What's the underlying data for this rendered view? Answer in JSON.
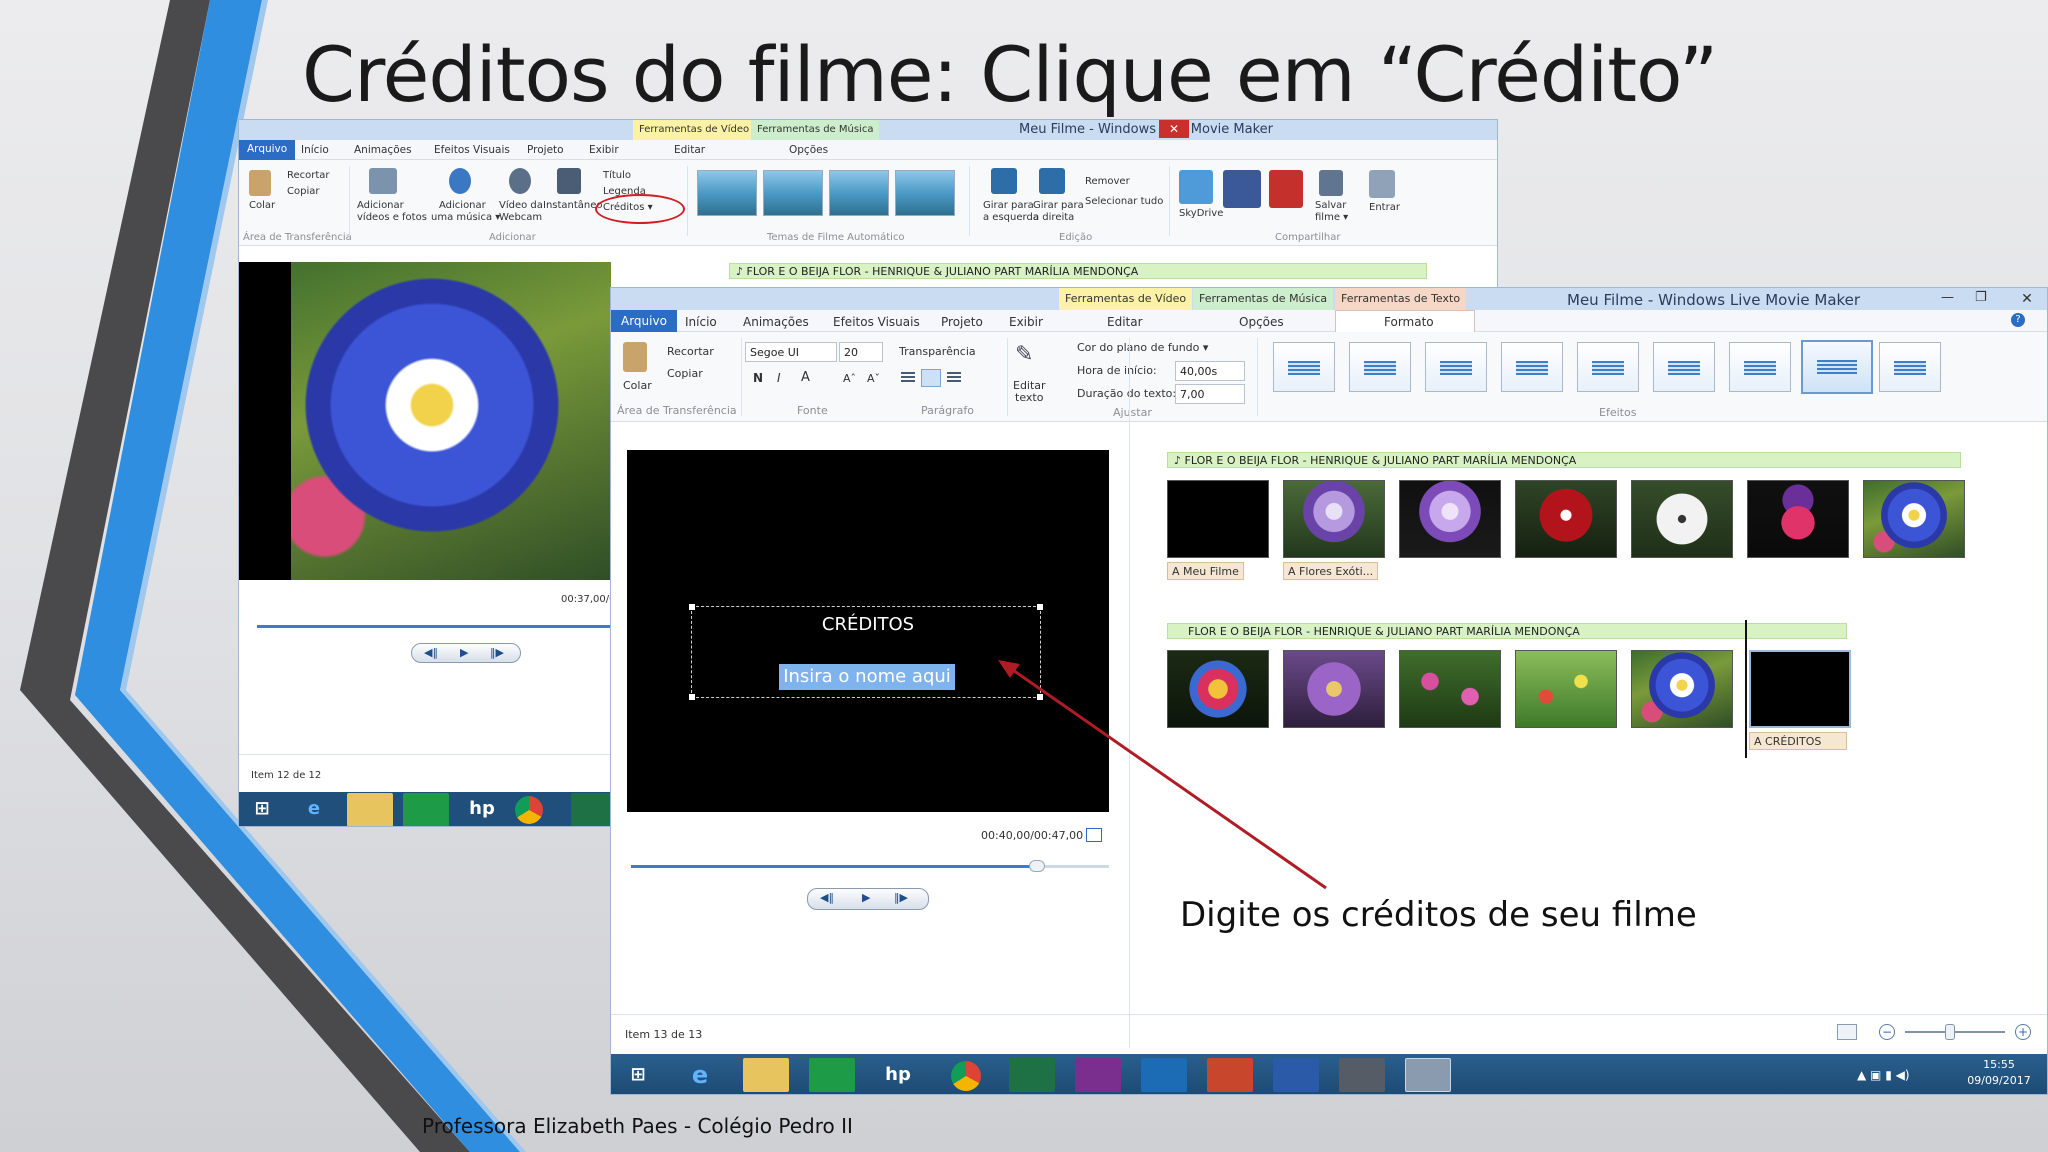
{
  "slide": {
    "title": "Créditos do filme: Clique em “Crédito”",
    "caption": "Digite os créditos de seu filme",
    "footer": "Professora Elizabeth Paes - Colégio Pedro II",
    "accent_blue": "#2f8ee0",
    "arrow_color": "#b01c24"
  },
  "back_window": {
    "title": "Meu Filme - Windows Live Movie Maker",
    "context_tabs": [
      "Ferramentas de Vídeo",
      "Ferramentas de Música"
    ],
    "context_subtabs": [
      "Editar",
      "Opções"
    ],
    "menu": [
      "Arquivo",
      "Início",
      "Animações",
      "Efeitos Visuais",
      "Projeto",
      "Exibir"
    ],
    "ribbon": {
      "paste": "Colar",
      "cut": "Recortar",
      "copy": "Copiar",
      "add_videos": [
        "Adicionar",
        "vídeos e fotos"
      ],
      "add_music": [
        "Adicionar",
        "uma música ▾"
      ],
      "webcam": [
        "Vídeo da",
        "Webcam"
      ],
      "snapshot": "Instantâneo",
      "titulo": "Título",
      "legenda": "Legenda",
      "creditos": "Créditos ▾",
      "rotate_left": [
        "Girar para",
        "a esquerda"
      ],
      "rotate_right": [
        "Girar para",
        "a direita"
      ],
      "remove": "Remover",
      "select_all": "Selecionar tudo",
      "skydrive": "SkyDrive",
      "save_movie": [
        "Salvar",
        "filme ▾"
      ],
      "signin": "Entrar",
      "groups": [
        "Área de Transferência",
        "Adicionar",
        "Temas de Filme Automático",
        "Edição",
        "Compartilhar"
      ]
    },
    "storyboard_header": "♪ FLOR E O BEIJA FLOR - HENRIQUE & JULIANO PART MARÍLIA MENDONÇA",
    "time": "00:37,00/0",
    "status": "Item 12 de 12"
  },
  "front_window": {
    "title": "Meu Filme - Windows Live Movie Maker",
    "context_tabs": [
      "Ferramentas de Vídeo",
      "Ferramentas de Música",
      "Ferramentas de Texto"
    ],
    "context_subtabs": [
      "Editar",
      "Opções",
      "Formato"
    ],
    "menu": [
      "Arquivo",
      "Início",
      "Animações",
      "Efeitos Visuais",
      "Projeto",
      "Exibir"
    ],
    "ribbon": {
      "paste": "Colar",
      "cut": "Recortar",
      "copy": "Copiar",
      "font": "Segoe UI",
      "size": "20",
      "transparency": "Transparência",
      "bold": "N",
      "italic": "I",
      "edit_text": [
        "Editar",
        "texto"
      ],
      "bg_color": "Cor do plano de fundo ▾",
      "start_time_label": "Hora de início:",
      "start_time": "40,00s",
      "duration_label": "Duração do texto:",
      "duration": "7,00",
      "groups": [
        "Área de Transferência",
        "Fonte",
        "Parágrafo",
        "Ajustar",
        "Efeitos"
      ]
    },
    "preview": {
      "credit_title": "CRÉDITOS",
      "credit_placeholder": "Insira o nome aqui",
      "time": "00:40,00/00:47,00"
    },
    "storyboard": {
      "row1_header": "♪ FLOR E O BEIJA FLOR - HENRIQUE & JULIANO PART MARÍLIA MENDONÇA",
      "row1_labels": [
        "A Meu Filme",
        "A Flores Exóti..."
      ],
      "row2_header": "FLOR E O BEIJA FLOR - HENRIQUE & JULIANO PART MARÍLIA MENDONÇA",
      "row2_label": "A CRÉDITOS"
    },
    "status": "Item 13 de 13",
    "clock_time": "15:55",
    "clock_date": "09/09/2017"
  }
}
